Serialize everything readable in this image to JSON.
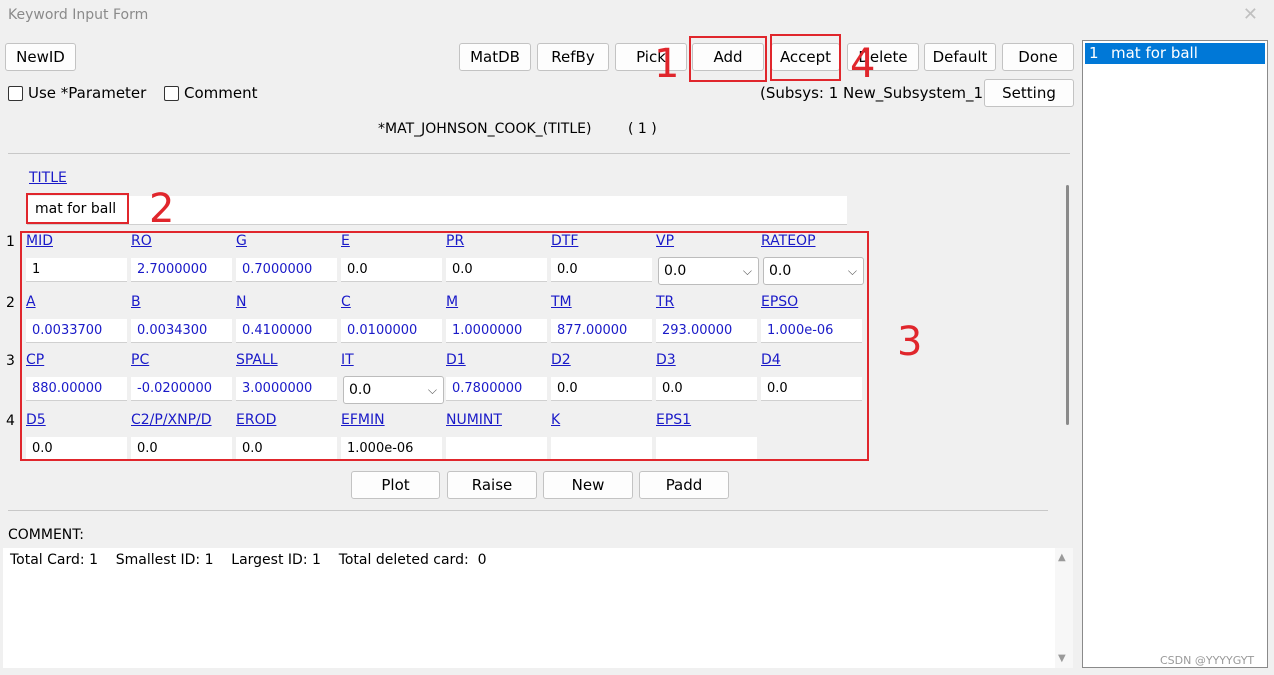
{
  "window": {
    "title": "Keyword Input Form",
    "close": "✕"
  },
  "toolbar": {
    "newid": "NewID",
    "matdb": "MatDB",
    "refby": "RefBy",
    "pick": "Pick",
    "add": "Add",
    "accept": "Accept",
    "delete": "Delete",
    "default": "Default",
    "done": "Done",
    "setting": "Setting"
  },
  "options": {
    "use_parameter": "Use *Parameter",
    "comment": "Comment",
    "subsys": "(Subsys: 1 New_Subsystem_1)"
  },
  "keyword": {
    "name": "*MAT_JOHNSON_COOK_(TITLE)",
    "count": "( 1 )"
  },
  "title_field": {
    "label": "TITLE",
    "value": "mat for ball"
  },
  "cards": [
    {
      "num": "1",
      "fields": [
        {
          "label": "MID",
          "value": "1",
          "style": "plain"
        },
        {
          "label": "RO",
          "value": "2.7000000",
          "style": "blue"
        },
        {
          "label": "G",
          "value": "0.7000000",
          "style": "blue"
        },
        {
          "label": "E",
          "value": "0.0",
          "style": "plain"
        },
        {
          "label": "PR",
          "value": "0.0",
          "style": "plain"
        },
        {
          "label": "DTF",
          "value": "0.0",
          "style": "plain"
        },
        {
          "label": "VP",
          "value": "0.0",
          "style": "select"
        },
        {
          "label": "RATEOP",
          "value": "0.0",
          "style": "select"
        }
      ]
    },
    {
      "num": "2",
      "fields": [
        {
          "label": "A",
          "value": "0.0033700",
          "style": "blue"
        },
        {
          "label": "B",
          "value": "0.0034300",
          "style": "blue"
        },
        {
          "label": "N",
          "value": "0.4100000",
          "style": "blue"
        },
        {
          "label": "C",
          "value": "0.0100000",
          "style": "blue"
        },
        {
          "label": "M",
          "value": "1.0000000",
          "style": "blue"
        },
        {
          "label": "TM",
          "value": "877.00000",
          "style": "blue"
        },
        {
          "label": "TR",
          "value": "293.00000",
          "style": "blue"
        },
        {
          "label": "EPSO",
          "value": "1.000e-06",
          "style": "blue"
        }
      ]
    },
    {
      "num": "3",
      "fields": [
        {
          "label": "CP",
          "value": "880.00000",
          "style": "blue"
        },
        {
          "label": "PC",
          "value": "-0.0200000",
          "style": "blue"
        },
        {
          "label": "SPALL",
          "value": "3.0000000",
          "style": "blue"
        },
        {
          "label": "IT",
          "value": "0.0",
          "style": "select"
        },
        {
          "label": "D1",
          "value": "0.7800000",
          "style": "blue"
        },
        {
          "label": "D2",
          "value": "0.0",
          "style": "plain"
        },
        {
          "label": "D3",
          "value": "0.0",
          "style": "plain"
        },
        {
          "label": "D4",
          "value": "0.0",
          "style": "plain"
        }
      ]
    },
    {
      "num": "4",
      "fields": [
        {
          "label": "D5",
          "value": "0.0",
          "style": "plain"
        },
        {
          "label": "C2/P/XNP/D",
          "value": "0.0",
          "style": "plain"
        },
        {
          "label": "EROD",
          "value": "0.0",
          "style": "plain"
        },
        {
          "label": "EFMIN",
          "value": "1.000e-06",
          "style": "plain"
        },
        {
          "label": "NUMINT",
          "value": "",
          "style": "plain"
        },
        {
          "label": "K",
          "value": "",
          "style": "plain"
        },
        {
          "label": "EPS1",
          "value": "",
          "style": "plain"
        }
      ]
    }
  ],
  "actions": {
    "plot": "Plot",
    "raise": "Raise",
    "new": "New",
    "padd": "Padd"
  },
  "comment": {
    "label": "COMMENT:",
    "stats": "Total Card: 1    Smallest ID: 1    Largest ID: 1    Total deleted card:  0"
  },
  "list": {
    "items": [
      {
        "id": "1",
        "name": "mat for ball"
      }
    ]
  },
  "watermark": "CSDN @YYYYGYT",
  "annotations": [
    "1",
    "2",
    "3",
    "4"
  ],
  "colors": {
    "annotation_red": "#e0262c",
    "link_blue": "#1a1ac8",
    "selection_blue": "#0078d7"
  }
}
